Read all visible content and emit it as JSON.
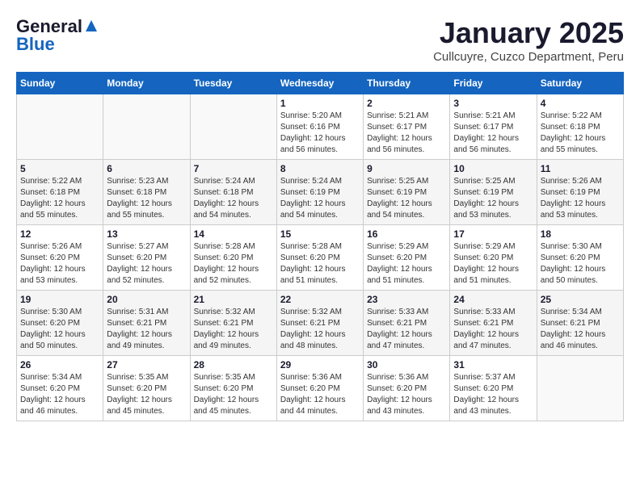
{
  "header": {
    "logo_general": "General",
    "logo_blue": "Blue",
    "month_title": "January 2025",
    "subtitle": "Cullcuyre, Cuzco Department, Peru"
  },
  "days_of_week": [
    "Sunday",
    "Monday",
    "Tuesday",
    "Wednesday",
    "Thursday",
    "Friday",
    "Saturday"
  ],
  "weeks": [
    [
      {
        "day": "",
        "info": ""
      },
      {
        "day": "",
        "info": ""
      },
      {
        "day": "",
        "info": ""
      },
      {
        "day": "1",
        "info": "Sunrise: 5:20 AM\nSunset: 6:16 PM\nDaylight: 12 hours\nand 56 minutes."
      },
      {
        "day": "2",
        "info": "Sunrise: 5:21 AM\nSunset: 6:17 PM\nDaylight: 12 hours\nand 56 minutes."
      },
      {
        "day": "3",
        "info": "Sunrise: 5:21 AM\nSunset: 6:17 PM\nDaylight: 12 hours\nand 56 minutes."
      },
      {
        "day": "4",
        "info": "Sunrise: 5:22 AM\nSunset: 6:18 PM\nDaylight: 12 hours\nand 55 minutes."
      }
    ],
    [
      {
        "day": "5",
        "info": "Sunrise: 5:22 AM\nSunset: 6:18 PM\nDaylight: 12 hours\nand 55 minutes."
      },
      {
        "day": "6",
        "info": "Sunrise: 5:23 AM\nSunset: 6:18 PM\nDaylight: 12 hours\nand 55 minutes."
      },
      {
        "day": "7",
        "info": "Sunrise: 5:24 AM\nSunset: 6:18 PM\nDaylight: 12 hours\nand 54 minutes."
      },
      {
        "day": "8",
        "info": "Sunrise: 5:24 AM\nSunset: 6:19 PM\nDaylight: 12 hours\nand 54 minutes."
      },
      {
        "day": "9",
        "info": "Sunrise: 5:25 AM\nSunset: 6:19 PM\nDaylight: 12 hours\nand 54 minutes."
      },
      {
        "day": "10",
        "info": "Sunrise: 5:25 AM\nSunset: 6:19 PM\nDaylight: 12 hours\nand 53 minutes."
      },
      {
        "day": "11",
        "info": "Sunrise: 5:26 AM\nSunset: 6:19 PM\nDaylight: 12 hours\nand 53 minutes."
      }
    ],
    [
      {
        "day": "12",
        "info": "Sunrise: 5:26 AM\nSunset: 6:20 PM\nDaylight: 12 hours\nand 53 minutes."
      },
      {
        "day": "13",
        "info": "Sunrise: 5:27 AM\nSunset: 6:20 PM\nDaylight: 12 hours\nand 52 minutes."
      },
      {
        "day": "14",
        "info": "Sunrise: 5:28 AM\nSunset: 6:20 PM\nDaylight: 12 hours\nand 52 minutes."
      },
      {
        "day": "15",
        "info": "Sunrise: 5:28 AM\nSunset: 6:20 PM\nDaylight: 12 hours\nand 51 minutes."
      },
      {
        "day": "16",
        "info": "Sunrise: 5:29 AM\nSunset: 6:20 PM\nDaylight: 12 hours\nand 51 minutes."
      },
      {
        "day": "17",
        "info": "Sunrise: 5:29 AM\nSunset: 6:20 PM\nDaylight: 12 hours\nand 51 minutes."
      },
      {
        "day": "18",
        "info": "Sunrise: 5:30 AM\nSunset: 6:20 PM\nDaylight: 12 hours\nand 50 minutes."
      }
    ],
    [
      {
        "day": "19",
        "info": "Sunrise: 5:30 AM\nSunset: 6:20 PM\nDaylight: 12 hours\nand 50 minutes."
      },
      {
        "day": "20",
        "info": "Sunrise: 5:31 AM\nSunset: 6:21 PM\nDaylight: 12 hours\nand 49 minutes."
      },
      {
        "day": "21",
        "info": "Sunrise: 5:32 AM\nSunset: 6:21 PM\nDaylight: 12 hours\nand 49 minutes."
      },
      {
        "day": "22",
        "info": "Sunrise: 5:32 AM\nSunset: 6:21 PM\nDaylight: 12 hours\nand 48 minutes."
      },
      {
        "day": "23",
        "info": "Sunrise: 5:33 AM\nSunset: 6:21 PM\nDaylight: 12 hours\nand 47 minutes."
      },
      {
        "day": "24",
        "info": "Sunrise: 5:33 AM\nSunset: 6:21 PM\nDaylight: 12 hours\nand 47 minutes."
      },
      {
        "day": "25",
        "info": "Sunrise: 5:34 AM\nSunset: 6:21 PM\nDaylight: 12 hours\nand 46 minutes."
      }
    ],
    [
      {
        "day": "26",
        "info": "Sunrise: 5:34 AM\nSunset: 6:20 PM\nDaylight: 12 hours\nand 46 minutes."
      },
      {
        "day": "27",
        "info": "Sunrise: 5:35 AM\nSunset: 6:20 PM\nDaylight: 12 hours\nand 45 minutes."
      },
      {
        "day": "28",
        "info": "Sunrise: 5:35 AM\nSunset: 6:20 PM\nDaylight: 12 hours\nand 45 minutes."
      },
      {
        "day": "29",
        "info": "Sunrise: 5:36 AM\nSunset: 6:20 PM\nDaylight: 12 hours\nand 44 minutes."
      },
      {
        "day": "30",
        "info": "Sunrise: 5:36 AM\nSunset: 6:20 PM\nDaylight: 12 hours\nand 43 minutes."
      },
      {
        "day": "31",
        "info": "Sunrise: 5:37 AM\nSunset: 6:20 PM\nDaylight: 12 hours\nand 43 minutes."
      },
      {
        "day": "",
        "info": ""
      }
    ]
  ]
}
